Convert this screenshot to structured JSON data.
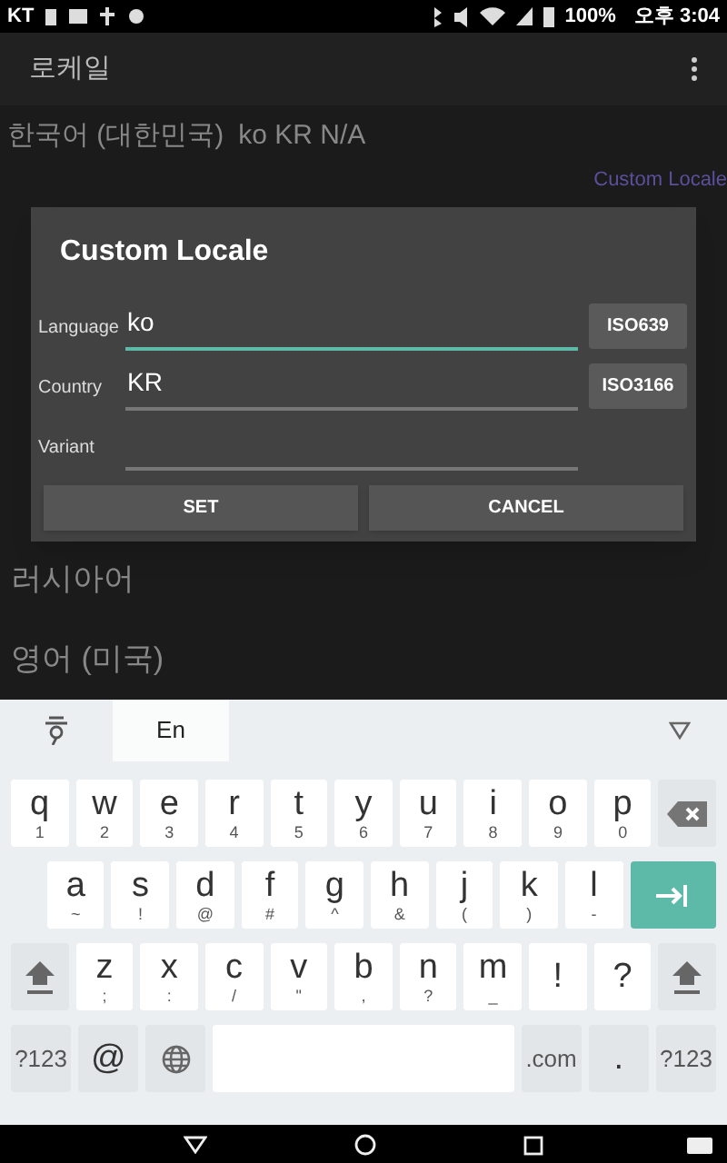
{
  "status_bar": {
    "carrier": "KT",
    "battery": "100%",
    "time": "오후 3:04"
  },
  "app_bar": {
    "title": "로케일"
  },
  "current": {
    "name": "한국어 (대한민국)",
    "codes": "ko KR N/A",
    "link": "Custom Locale"
  },
  "list": [
    "러시아어",
    "영어 (미국)"
  ],
  "dialog": {
    "title": "Custom Locale",
    "fields": [
      {
        "label": "Language",
        "value": "ko",
        "focused": true,
        "button": "ISO639"
      },
      {
        "label": "Country",
        "value": "KR",
        "focused": false,
        "button": "ISO3166"
      },
      {
        "label": "Variant",
        "focused": false
      }
    ],
    "buttons": [
      "SET",
      "CANCEL"
    ]
  },
  "keyboard": {
    "tabs": [
      {
        "kind": "hangul",
        "selected": false
      },
      {
        "kind": "text",
        "label": "En",
        "selected": true
      }
    ],
    "rows": [
      {
        "keys": [
          {
            "kind": "char",
            "label": "q",
            "sub": "1"
          },
          {
            "kind": "char",
            "label": "w",
            "sub": "2"
          },
          {
            "kind": "char",
            "label": "e",
            "sub": "3"
          },
          {
            "kind": "char",
            "label": "r",
            "sub": "4"
          },
          {
            "kind": "char",
            "label": "t",
            "sub": "5"
          },
          {
            "kind": "char",
            "label": "y",
            "sub": "6"
          },
          {
            "kind": "char",
            "label": "u",
            "sub": "7"
          },
          {
            "kind": "char",
            "label": "i",
            "sub": "8"
          },
          {
            "kind": "char",
            "label": "o",
            "sub": "9"
          },
          {
            "kind": "char",
            "label": "p",
            "sub": "0"
          },
          {
            "kind": "backspace"
          }
        ]
      },
      {
        "keys": [
          {
            "kind": "char",
            "label": "a",
            "sub": "~"
          },
          {
            "kind": "char",
            "label": "s",
            "sub": "!"
          },
          {
            "kind": "char",
            "label": "d",
            "sub": "@"
          },
          {
            "kind": "char",
            "label": "f",
            "sub": "#"
          },
          {
            "kind": "char",
            "label": "g",
            "sub": "^"
          },
          {
            "kind": "char",
            "label": "h",
            "sub": "&"
          },
          {
            "kind": "char",
            "label": "j",
            "sub": "("
          },
          {
            "kind": "char",
            "label": "k",
            "sub": ")"
          },
          {
            "kind": "char",
            "label": "l",
            "sub": "-"
          },
          {
            "kind": "enter"
          }
        ]
      },
      {
        "keys": [
          {
            "kind": "shift"
          },
          {
            "kind": "char",
            "label": "z",
            "sub": ";"
          },
          {
            "kind": "char",
            "label": "x",
            "sub": ":"
          },
          {
            "kind": "char",
            "label": "c",
            "sub": "/"
          },
          {
            "kind": "char",
            "label": "v",
            "sub": "\""
          },
          {
            "kind": "char",
            "label": "b",
            "sub": ","
          },
          {
            "kind": "char",
            "label": "n",
            "sub": "?"
          },
          {
            "kind": "char",
            "label": "m",
            "sub": "_"
          },
          {
            "kind": "char",
            "label": "!"
          },
          {
            "kind": "char",
            "label": "?"
          },
          {
            "kind": "shift"
          }
        ]
      },
      {
        "keys": [
          {
            "kind": "func",
            "label": "?123"
          },
          {
            "kind": "func",
            "label": "@"
          },
          {
            "kind": "globe"
          },
          {
            "kind": "space"
          },
          {
            "kind": "func",
            "label": ".com"
          },
          {
            "kind": "func",
            "label": "."
          },
          {
            "kind": "func",
            "label": "?123"
          }
        ]
      }
    ]
  }
}
